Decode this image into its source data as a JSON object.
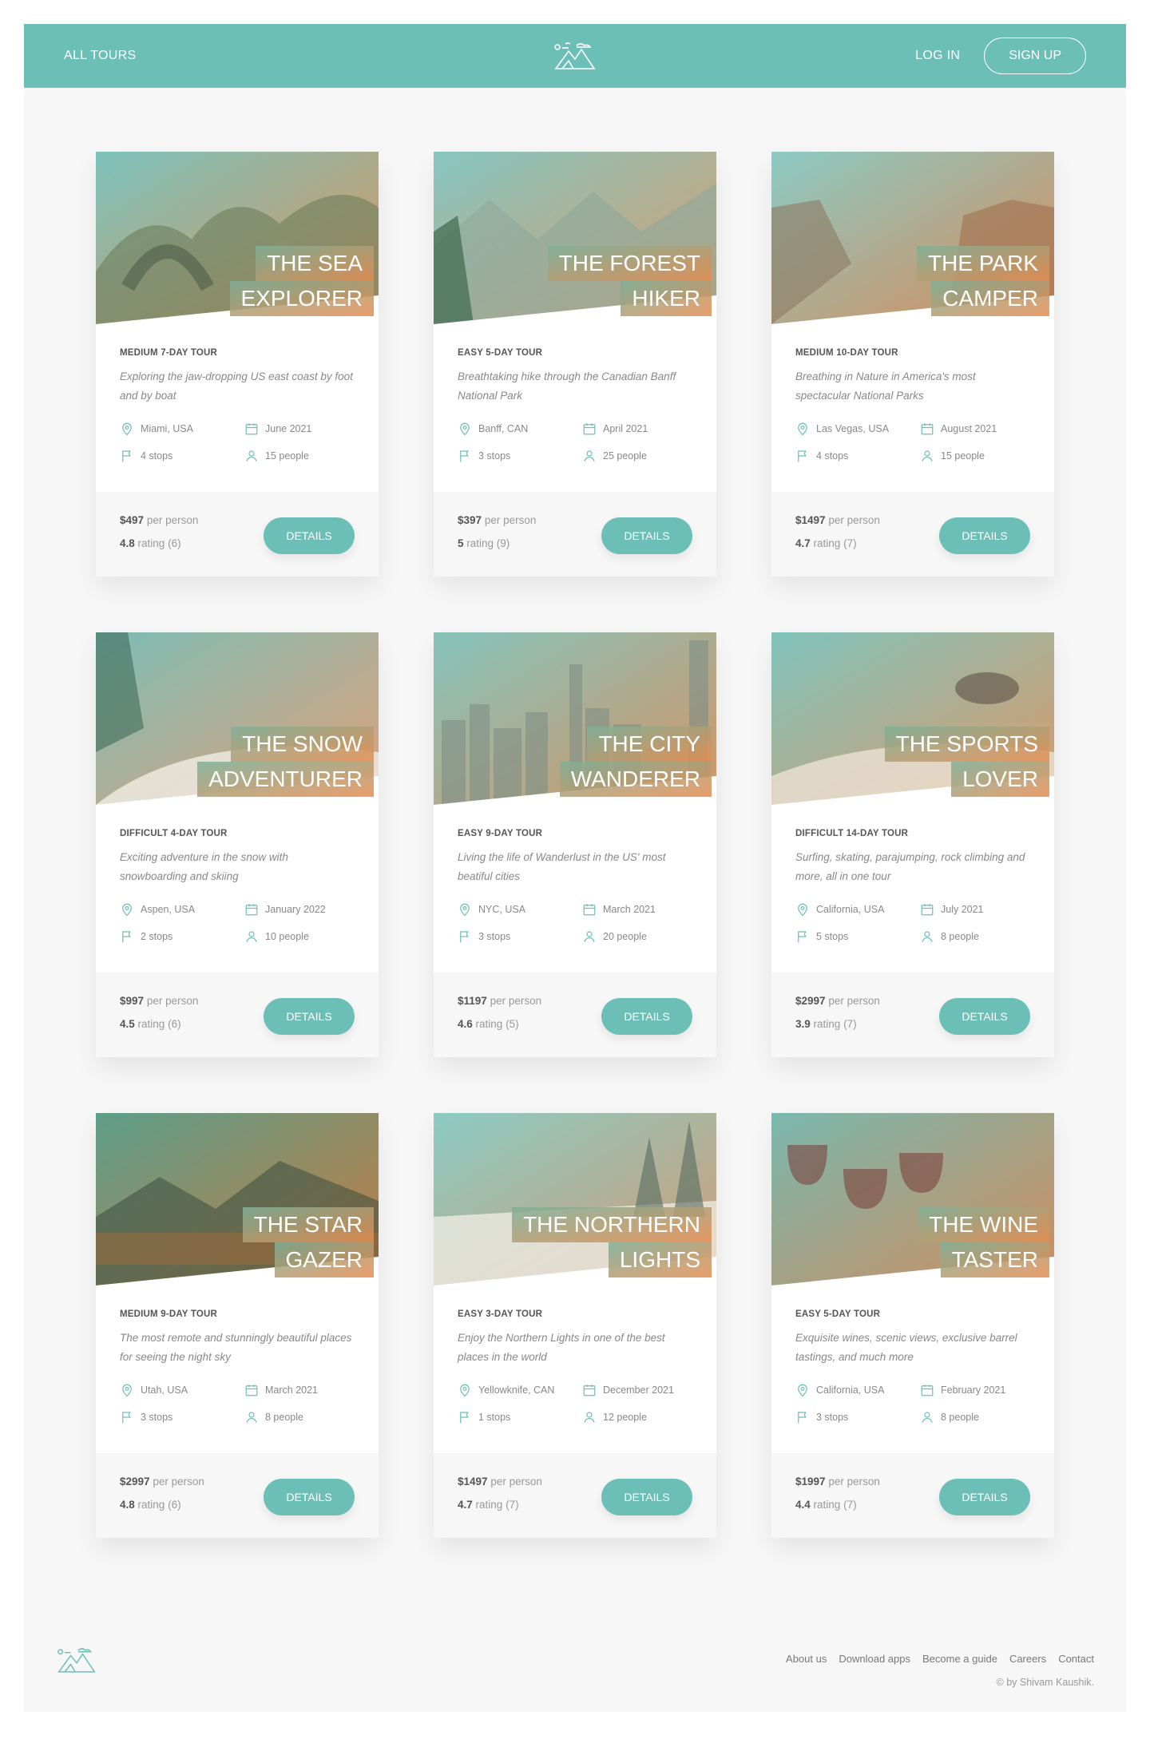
{
  "header": {
    "all_tours": "All tours",
    "login": "Log in",
    "signup": "Sign up",
    "logo_icon": "mountains-logo-icon"
  },
  "colors": {
    "accent": "#6cbfb7",
    "gradient_start": "#7eb098",
    "gradient_end": "#e68c50",
    "background": "#f7f7f7"
  },
  "cards": [
    {
      "name_1": "The Sea",
      "name_2": "Explorer",
      "difficulty": "Medium 7-day tour",
      "summary": "Exploring the jaw-dropping US east coast by foot and by boat",
      "location": "Miami, USA",
      "date": "June 2021",
      "stops": "4 stops",
      "people": "15 people",
      "price": "$497",
      "price_unit": "per person",
      "rating": "4.8",
      "rating_label": "rating (6)",
      "button": "Details"
    },
    {
      "name_1": "The Forest",
      "name_2": "Hiker",
      "difficulty": "Easy 5-day tour",
      "summary": "Breathtaking hike through the Canadian Banff National Park",
      "location": "Banff, CAN",
      "date": "April 2021",
      "stops": "3 stops",
      "people": "25 people",
      "price": "$397",
      "price_unit": "per person",
      "rating": "5",
      "rating_label": "rating (9)",
      "button": "Details"
    },
    {
      "name_1": "The Park",
      "name_2": "Camper",
      "difficulty": "Medium 10-day tour",
      "summary": "Breathing in Nature in America's most spectacular National Parks",
      "location": "Las Vegas, USA",
      "date": "August 2021",
      "stops": "4 stops",
      "people": "15 people",
      "price": "$1497",
      "price_unit": "per person",
      "rating": "4.7",
      "rating_label": "rating (7)",
      "button": "Details"
    },
    {
      "name_1": "The Snow",
      "name_2": "Adventurer",
      "difficulty": "Difficult 4-day tour",
      "summary": "Exciting adventure in the snow with snowboarding and skiing",
      "location": "Aspen, USA",
      "date": "January 2022",
      "stops": "2 stops",
      "people": "10 people",
      "price": "$997",
      "price_unit": "per person",
      "rating": "4.5",
      "rating_label": "rating (6)",
      "button": "Details"
    },
    {
      "name_1": "The City",
      "name_2": "Wanderer",
      "difficulty": "Easy 9-day tour",
      "summary": "Living the life of Wanderlust in the US' most beatiful cities",
      "location": "NYC, USA",
      "date": "March 2021",
      "stops": "3 stops",
      "people": "20 people",
      "price": "$1197",
      "price_unit": "per person",
      "rating": "4.6",
      "rating_label": "rating (5)",
      "button": "Details"
    },
    {
      "name_1": "The Sports",
      "name_2": "Lover",
      "difficulty": "Difficult 14-day tour",
      "summary": "Surfing, skating, parajumping, rock climbing and more, all in one tour",
      "location": "California, USA",
      "date": "July 2021",
      "stops": "5 stops",
      "people": "8 people",
      "price": "$2997",
      "price_unit": "per person",
      "rating": "3.9",
      "rating_label": "rating (7)",
      "button": "Details"
    },
    {
      "name_1": "The Star",
      "name_2": "Gazer",
      "difficulty": "Medium 9-day tour",
      "summary": "The most remote and stunningly beautiful places for seeing the night sky",
      "location": "Utah, USA",
      "date": "March 2021",
      "stops": "3 stops",
      "people": "8 people",
      "price": "$2997",
      "price_unit": "per person",
      "rating": "4.8",
      "rating_label": "rating (6)",
      "button": "Details"
    },
    {
      "name_1": "The Northern",
      "name_2": "Lights",
      "difficulty": "Easy 3-day tour",
      "summary": "Enjoy the Northern Lights in one of the best places in the world",
      "location": "Yellowknife, CAN",
      "date": "December 2021",
      "stops": "1 stops",
      "people": "12 people",
      "price": "$1497",
      "price_unit": "per person",
      "rating": "4.7",
      "rating_label": "rating (7)",
      "button": "Details"
    },
    {
      "name_1": "The Wine",
      "name_2": "Taster",
      "difficulty": "Easy 5-day tour",
      "summary": "Exquisite wines, scenic views, exclusive barrel tastings, and much more",
      "location": "California, USA",
      "date": "February 2021",
      "stops": "3 stops",
      "people": "8 people",
      "price": "$1997",
      "price_unit": "per person",
      "rating": "4.4",
      "rating_label": "rating (7)",
      "button": "Details"
    }
  ],
  "footer": {
    "links": [
      "About us",
      "Download apps",
      "Become a guide",
      "Careers",
      "Contact"
    ],
    "copyright": "© by Shivam Kaushik."
  }
}
